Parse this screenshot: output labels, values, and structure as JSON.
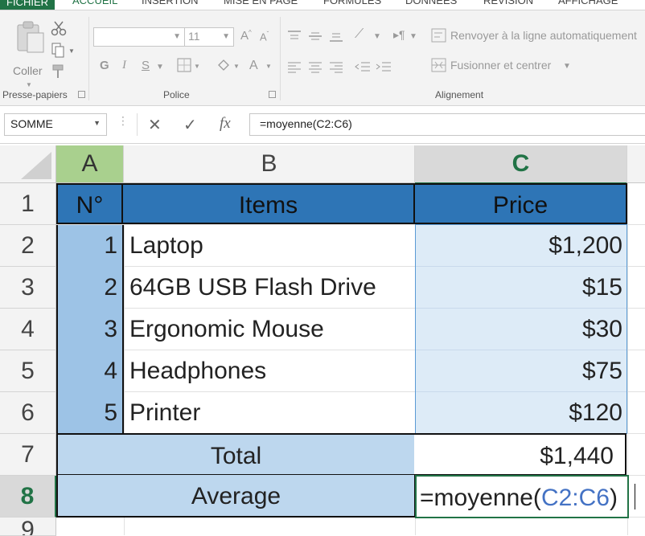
{
  "ribbon": {
    "tabs": [
      "FICHIER",
      "ACCUEIL",
      "INSERTION",
      "MISE EN PAGE",
      "FORMULES",
      "DONNÉES",
      "RÉVISION",
      "AFFICHAGE"
    ],
    "clipboard": {
      "paste_label": "Coller",
      "group_label": "Presse-papiers"
    },
    "font": {
      "size_value": "11",
      "bold": "G",
      "italic": "I",
      "underline": "S",
      "group_label": "Police"
    },
    "alignment": {
      "wrap_label": "Renvoyer à la ligne automatiquement",
      "merge_label": "Fusionner et centrer",
      "group_label": "Alignement"
    }
  },
  "formula_bar": {
    "name_box": "SOMME",
    "fx_label": "fx",
    "formula": "=moyenne(C2:C6)"
  },
  "columns": [
    "A",
    "B",
    "C"
  ],
  "rows": [
    "1",
    "2",
    "3",
    "4",
    "5",
    "6",
    "7",
    "8",
    "9"
  ],
  "table": {
    "headers": {
      "no": "N°",
      "items": "Items",
      "price": "Price"
    },
    "items": [
      {
        "no": "1",
        "item": "Laptop",
        "price": "$1,200"
      },
      {
        "no": "2",
        "item": "64GB USB Flash Drive",
        "price": "$15"
      },
      {
        "no": "3",
        "item": "Ergonomic Mouse",
        "price": "$30"
      },
      {
        "no": "4",
        "item": "Headphones",
        "price": "$75"
      },
      {
        "no": "5",
        "item": "Printer",
        "price": "$120"
      }
    ],
    "total_label": "Total",
    "total_value": "$1,440",
    "average_label": "Average",
    "editing": {
      "prefix": "=moyenne(",
      "ref": "C2:C6",
      "suffix": ")"
    }
  },
  "colors": {
    "header_fill": "#2e75b6",
    "no_fill": "#9dc3e6",
    "summary_fill": "#bdd7ee",
    "range_highlight": "#ddebf7",
    "accent": "#217346",
    "ref_color": "#4472c4"
  }
}
